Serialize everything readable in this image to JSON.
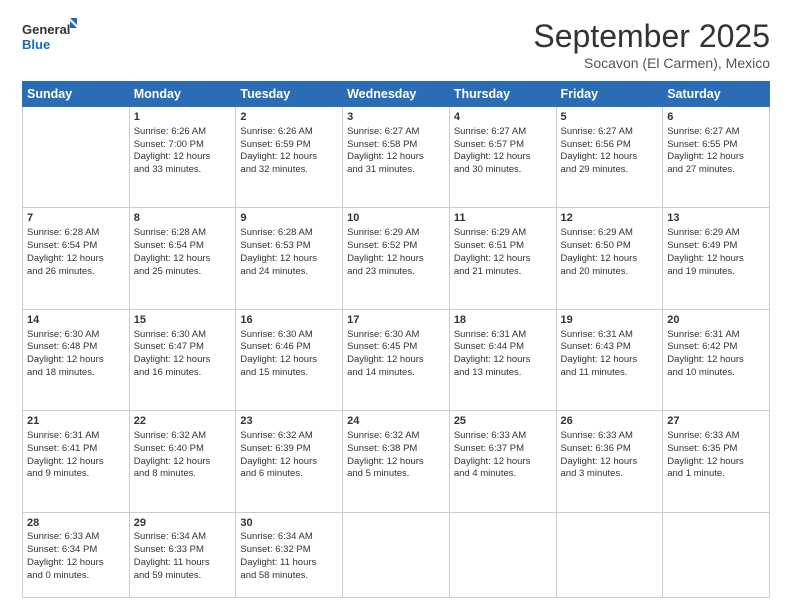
{
  "header": {
    "logo_line1": "General",
    "logo_line2": "Blue",
    "month_title": "September 2025",
    "subtitle": "Socavon (El Carmen), Mexico"
  },
  "weekdays": [
    "Sunday",
    "Monday",
    "Tuesday",
    "Wednesday",
    "Thursday",
    "Friday",
    "Saturday"
  ],
  "weeks": [
    [
      {
        "day": "",
        "lines": []
      },
      {
        "day": "1",
        "lines": [
          "Sunrise: 6:26 AM",
          "Sunset: 7:00 PM",
          "Daylight: 12 hours",
          "and 33 minutes."
        ]
      },
      {
        "day": "2",
        "lines": [
          "Sunrise: 6:26 AM",
          "Sunset: 6:59 PM",
          "Daylight: 12 hours",
          "and 32 minutes."
        ]
      },
      {
        "day": "3",
        "lines": [
          "Sunrise: 6:27 AM",
          "Sunset: 6:58 PM",
          "Daylight: 12 hours",
          "and 31 minutes."
        ]
      },
      {
        "day": "4",
        "lines": [
          "Sunrise: 6:27 AM",
          "Sunset: 6:57 PM",
          "Daylight: 12 hours",
          "and 30 minutes."
        ]
      },
      {
        "day": "5",
        "lines": [
          "Sunrise: 6:27 AM",
          "Sunset: 6:56 PM",
          "Daylight: 12 hours",
          "and 29 minutes."
        ]
      },
      {
        "day": "6",
        "lines": [
          "Sunrise: 6:27 AM",
          "Sunset: 6:55 PM",
          "Daylight: 12 hours",
          "and 27 minutes."
        ]
      }
    ],
    [
      {
        "day": "7",
        "lines": [
          "Sunrise: 6:28 AM",
          "Sunset: 6:54 PM",
          "Daylight: 12 hours",
          "and 26 minutes."
        ]
      },
      {
        "day": "8",
        "lines": [
          "Sunrise: 6:28 AM",
          "Sunset: 6:54 PM",
          "Daylight: 12 hours",
          "and 25 minutes."
        ]
      },
      {
        "day": "9",
        "lines": [
          "Sunrise: 6:28 AM",
          "Sunset: 6:53 PM",
          "Daylight: 12 hours",
          "and 24 minutes."
        ]
      },
      {
        "day": "10",
        "lines": [
          "Sunrise: 6:29 AM",
          "Sunset: 6:52 PM",
          "Daylight: 12 hours",
          "and 23 minutes."
        ]
      },
      {
        "day": "11",
        "lines": [
          "Sunrise: 6:29 AM",
          "Sunset: 6:51 PM",
          "Daylight: 12 hours",
          "and 21 minutes."
        ]
      },
      {
        "day": "12",
        "lines": [
          "Sunrise: 6:29 AM",
          "Sunset: 6:50 PM",
          "Daylight: 12 hours",
          "and 20 minutes."
        ]
      },
      {
        "day": "13",
        "lines": [
          "Sunrise: 6:29 AM",
          "Sunset: 6:49 PM",
          "Daylight: 12 hours",
          "and 19 minutes."
        ]
      }
    ],
    [
      {
        "day": "14",
        "lines": [
          "Sunrise: 6:30 AM",
          "Sunset: 6:48 PM",
          "Daylight: 12 hours",
          "and 18 minutes."
        ]
      },
      {
        "day": "15",
        "lines": [
          "Sunrise: 6:30 AM",
          "Sunset: 6:47 PM",
          "Daylight: 12 hours",
          "and 16 minutes."
        ]
      },
      {
        "day": "16",
        "lines": [
          "Sunrise: 6:30 AM",
          "Sunset: 6:46 PM",
          "Daylight: 12 hours",
          "and 15 minutes."
        ]
      },
      {
        "day": "17",
        "lines": [
          "Sunrise: 6:30 AM",
          "Sunset: 6:45 PM",
          "Daylight: 12 hours",
          "and 14 minutes."
        ]
      },
      {
        "day": "18",
        "lines": [
          "Sunrise: 6:31 AM",
          "Sunset: 6:44 PM",
          "Daylight: 12 hours",
          "and 13 minutes."
        ]
      },
      {
        "day": "19",
        "lines": [
          "Sunrise: 6:31 AM",
          "Sunset: 6:43 PM",
          "Daylight: 12 hours",
          "and 11 minutes."
        ]
      },
      {
        "day": "20",
        "lines": [
          "Sunrise: 6:31 AM",
          "Sunset: 6:42 PM",
          "Daylight: 12 hours",
          "and 10 minutes."
        ]
      }
    ],
    [
      {
        "day": "21",
        "lines": [
          "Sunrise: 6:31 AM",
          "Sunset: 6:41 PM",
          "Daylight: 12 hours",
          "and 9 minutes."
        ]
      },
      {
        "day": "22",
        "lines": [
          "Sunrise: 6:32 AM",
          "Sunset: 6:40 PM",
          "Daylight: 12 hours",
          "and 8 minutes."
        ]
      },
      {
        "day": "23",
        "lines": [
          "Sunrise: 6:32 AM",
          "Sunset: 6:39 PM",
          "Daylight: 12 hours",
          "and 6 minutes."
        ]
      },
      {
        "day": "24",
        "lines": [
          "Sunrise: 6:32 AM",
          "Sunset: 6:38 PM",
          "Daylight: 12 hours",
          "and 5 minutes."
        ]
      },
      {
        "day": "25",
        "lines": [
          "Sunrise: 6:33 AM",
          "Sunset: 6:37 PM",
          "Daylight: 12 hours",
          "and 4 minutes."
        ]
      },
      {
        "day": "26",
        "lines": [
          "Sunrise: 6:33 AM",
          "Sunset: 6:36 PM",
          "Daylight: 12 hours",
          "and 3 minutes."
        ]
      },
      {
        "day": "27",
        "lines": [
          "Sunrise: 6:33 AM",
          "Sunset: 6:35 PM",
          "Daylight: 12 hours",
          "and 1 minute."
        ]
      }
    ],
    [
      {
        "day": "28",
        "lines": [
          "Sunrise: 6:33 AM",
          "Sunset: 6:34 PM",
          "Daylight: 12 hours",
          "and 0 minutes."
        ]
      },
      {
        "day": "29",
        "lines": [
          "Sunrise: 6:34 AM",
          "Sunset: 6:33 PM",
          "Daylight: 11 hours",
          "and 59 minutes."
        ]
      },
      {
        "day": "30",
        "lines": [
          "Sunrise: 6:34 AM",
          "Sunset: 6:32 PM",
          "Daylight: 11 hours",
          "and 58 minutes."
        ]
      },
      {
        "day": "",
        "lines": []
      },
      {
        "day": "",
        "lines": []
      },
      {
        "day": "",
        "lines": []
      },
      {
        "day": "",
        "lines": []
      }
    ]
  ]
}
